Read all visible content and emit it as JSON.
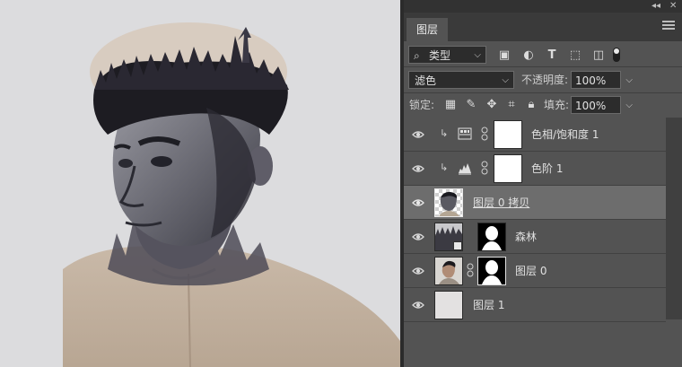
{
  "panel": {
    "title": "图层",
    "strip_icons": {
      "collapse": "◂◂",
      "close": "✕"
    },
    "filter_kind": "类型",
    "blend_mode": "滤色",
    "opacity_label": "不透明度:",
    "opacity_value": "100%",
    "lock_label": "锁定:",
    "fill_label": "填充:",
    "fill_value": "100%"
  },
  "filter_icons": [
    "image-filter-icon",
    "adjustment-filter-icon",
    "type-filter-icon",
    "shape-filter-icon",
    "smartobject-filter-icon",
    "filter-toggle-icon"
  ],
  "lock_icons": [
    "lock-transparent-pixels-icon",
    "lock-image-pixels-icon",
    "lock-position-icon",
    "lock-artboard-icon",
    "lock-all-icon"
  ],
  "layers": [
    {
      "name": "色相/饱和度 1",
      "type": "adjustment",
      "adjustment": "hue-saturation",
      "clipped": true,
      "visible": true,
      "selected": false
    },
    {
      "name": "色阶 1",
      "type": "adjustment",
      "adjustment": "levels",
      "clipped": true,
      "visible": true,
      "selected": false
    },
    {
      "name": "图层 0 拷贝",
      "type": "pixel",
      "visible": true,
      "selected": true
    },
    {
      "name": "森林",
      "type": "smart-object-masked",
      "visible": true,
      "selected": false
    },
    {
      "name": "图层 0",
      "type": "pixel-masked",
      "visible": true,
      "selected": false
    },
    {
      "name": "图层 1",
      "type": "pixel",
      "visible": true,
      "selected": false
    }
  ],
  "colors": {
    "panel_bg": "#535353",
    "panel_dark": "#3a3a3a",
    "field_bg": "#2c2c2c",
    "selected_row": "#6d6d6d",
    "canvas_bg": "#dcdcde"
  }
}
